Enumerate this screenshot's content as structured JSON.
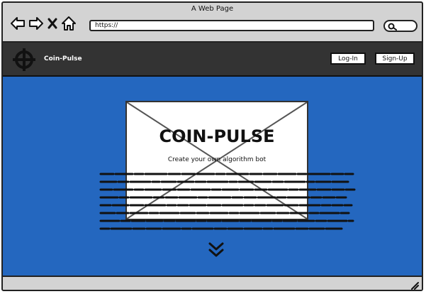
{
  "window": {
    "title": "A Web Page"
  },
  "browser": {
    "url": "https://",
    "icons": [
      "back-arrow-icon",
      "forward-arrow-icon",
      "close-x-icon",
      "home-icon",
      "search-icon"
    ]
  },
  "header": {
    "brand": "Coin-Pulse",
    "login_label": "Log-In",
    "signup_label": "Sign-Up",
    "logo_icon": "crosshair-logo-icon"
  },
  "hero": {
    "title": "COIN-PULSE",
    "subtitle": "Create your own algorithm bot",
    "background_color": "#2467bf",
    "scroll_icon": "double-chevron-down-icon"
  }
}
